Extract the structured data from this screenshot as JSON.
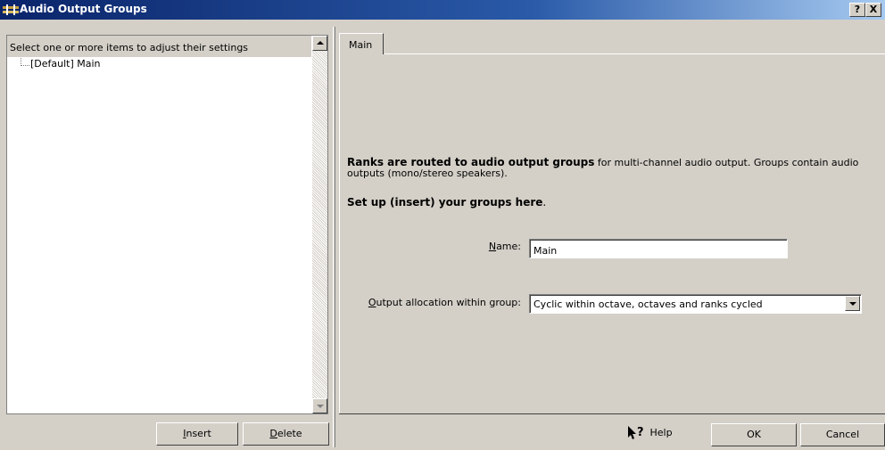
{
  "window": {
    "title": "Audio Output Groups",
    "help_button": "?",
    "close_button": "X"
  },
  "tree": {
    "header": "Select one or more items to adjust their settings",
    "items": [
      {
        "label": "[Default] Main"
      }
    ]
  },
  "left_buttons": {
    "insert": {
      "mnemonic": "I",
      "rest": "nsert"
    },
    "delete": {
      "mnemonic": "D",
      "rest": "elete"
    }
  },
  "tabs": [
    {
      "label": "Main"
    }
  ],
  "main": {
    "intro_bold": "Ranks are routed to audio output groups",
    "intro_rest": " for multi-channel audio output. Groups contain audio outputs (mono/stereo speakers).",
    "setup_bold": "Set up (insert) your groups here",
    "setup_rest": ".",
    "name_label": {
      "mnemonic": "N",
      "rest": "ame:"
    },
    "name_value": "Main",
    "allocation_label": {
      "mnemonic": "O",
      "rest": "utput allocation within group:"
    },
    "allocation_value": "Cyclic within octave, octaves and ranks cycled"
  },
  "footer": {
    "help": "Help",
    "ok": "OK",
    "cancel": "Cancel"
  },
  "icons": {
    "app": "organ-pipes-icon",
    "help": "help-pointer-icon"
  },
  "colors": {
    "titlebar_start": "#0a246a",
    "titlebar_end": "#a6caf0",
    "face": "#d4d0c8"
  }
}
